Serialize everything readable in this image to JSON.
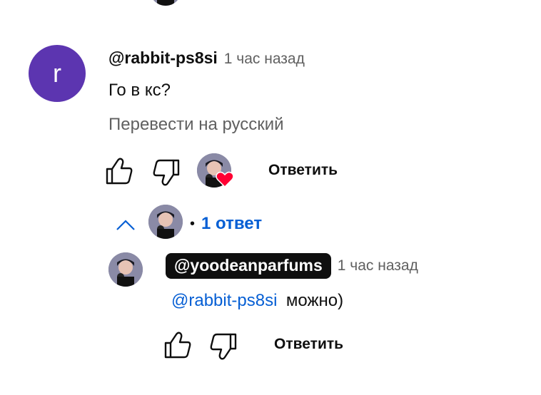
{
  "comment": {
    "avatar_letter": "r",
    "author": "@rabbit-ps8si",
    "time": "1 час назад",
    "text": "Го в кс?",
    "translate_label": "Перевести на русский",
    "reply_label": "Ответить",
    "heart_color": "#ff0033"
  },
  "replies_toggle": {
    "bullet": "•",
    "label": "1 ответ"
  },
  "reply": {
    "author": "@yoodeanparfums",
    "time": "1 час назад",
    "mention": "@rabbit-ps8si",
    "text": "можно)",
    "reply_label": "Ответить"
  },
  "colors": {
    "avatar_bg": "#5c35b0",
    "link_blue": "#065fd4",
    "secondary_text": "#606060"
  }
}
